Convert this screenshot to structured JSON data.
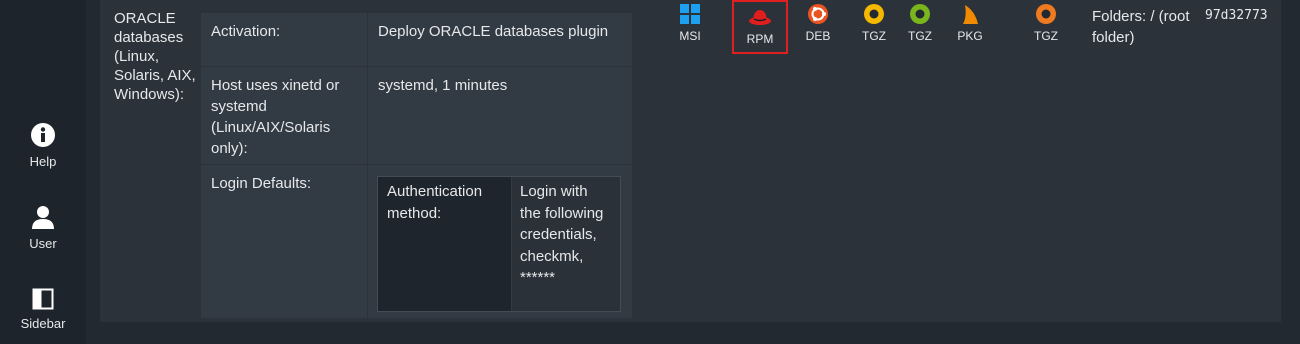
{
  "nav": {
    "items": [
      {
        "label": "Help",
        "icon": "info-circle-icon"
      },
      {
        "label": "User",
        "icon": "user-icon"
      },
      {
        "label": "Sidebar",
        "icon": "sidebar-icon"
      }
    ]
  },
  "agent": {
    "row_label": "ORACLE databases (Linux, Solaris, AIX, Windows):",
    "settings": [
      {
        "key": "Activation:",
        "value": "Deploy ORACLE databases plugin"
      },
      {
        "key": "Host uses xinetd or systemd (Linux/AIX/Solaris only):",
        "value": "systemd, 1 minutes"
      },
      {
        "key": "Login Defaults:"
      }
    ],
    "login": {
      "method_label": "Authentication method:",
      "method_value": "Login with the following credentials, checkmk, ******"
    }
  },
  "packages": [
    {
      "label": "MSI",
      "icon": "windows-icon",
      "color": "#1ea0f0"
    },
    {
      "label": "RPM",
      "icon": "redhat-icon",
      "color": "#e01e1e",
      "selected": true
    },
    {
      "label": "DEB",
      "icon": "ubuntu-icon",
      "color": "#e95420"
    },
    {
      "label": "TGZ",
      "icon": "solaris-icon",
      "color": "#f5b800"
    },
    {
      "label": "TGZ",
      "icon": "aix-icon",
      "color": "#7ab51d"
    },
    {
      "label": "PKG",
      "icon": "pkg-icon",
      "color": "#f08a00"
    },
    {
      "label": "TGZ",
      "icon": "tgz-icon",
      "color": "#f07a20"
    }
  ],
  "folders": "Folders: / (root folder)",
  "hash": "97d32773"
}
